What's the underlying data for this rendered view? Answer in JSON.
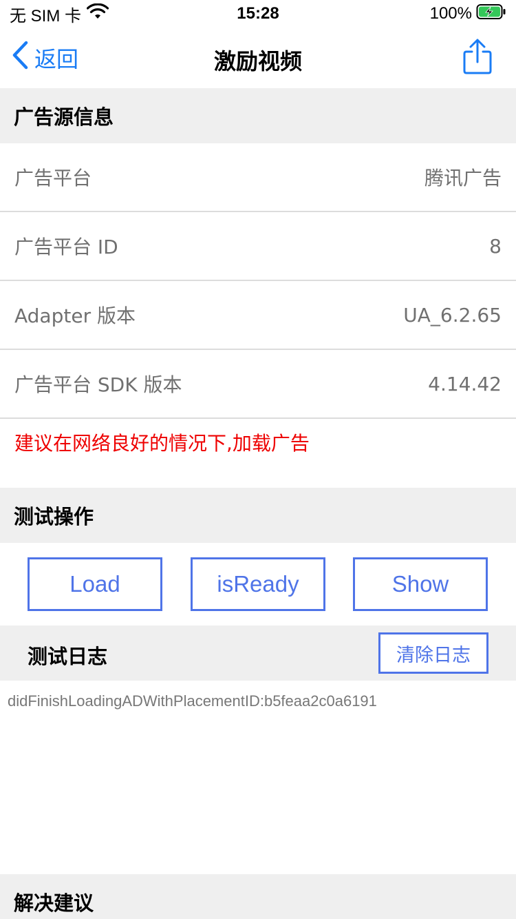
{
  "status_bar": {
    "carrier": "无 SIM 卡",
    "time": "15:28",
    "battery": "100%"
  },
  "nav": {
    "back_label": "返回",
    "title": "激励视频"
  },
  "source_info": {
    "header": "广告源信息",
    "rows": [
      {
        "label": "广告平台",
        "value": "腾讯广告"
      },
      {
        "label": "广告平台 ID",
        "value": "8"
      },
      {
        "label": "Adapter 版本",
        "value": "UA_6.2.65"
      },
      {
        "label": "广告平台 SDK 版本",
        "value": "4.14.42"
      }
    ],
    "hint": "建议在网络良好的情况下,加载广告"
  },
  "test_ops": {
    "header": "测试操作",
    "load_label": "Load",
    "is_ready_label": "isReady",
    "show_label": "Show"
  },
  "log": {
    "title": "测试日志",
    "clear_label": "清除日志",
    "lines": [
      "didFinishLoadingADWithPlacementID:b5feaa2c0a6191"
    ]
  },
  "solution": {
    "header": "解决建议"
  },
  "colors": {
    "accent": "#1a7cf5",
    "button_border": "#4f74e8",
    "hint": "#ee0000",
    "section_bg": "#efefef"
  }
}
